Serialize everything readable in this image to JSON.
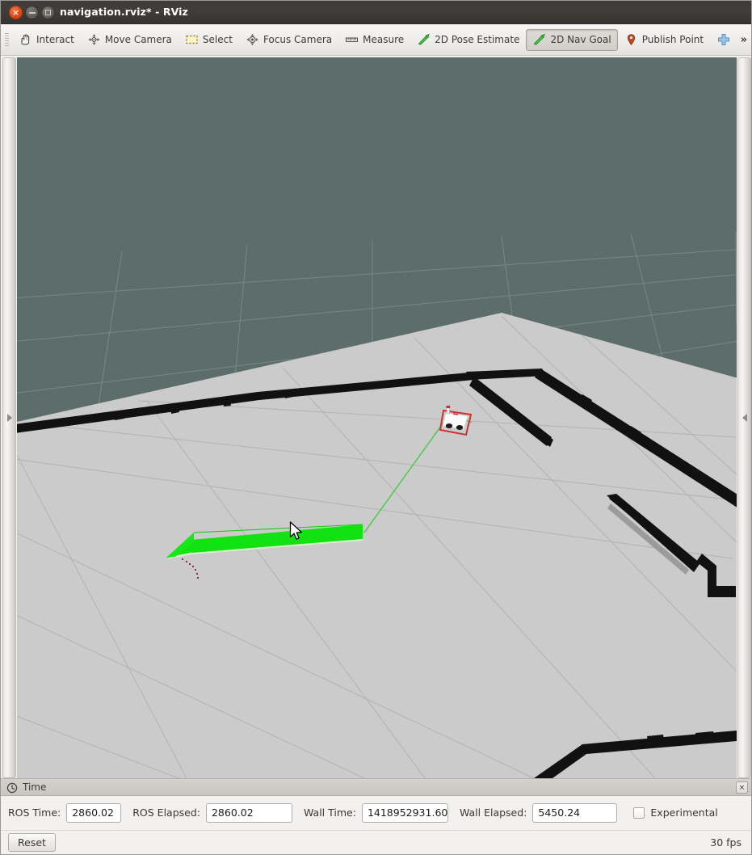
{
  "window": {
    "title": "navigation.rviz* - RViz",
    "buttons": {
      "close": "×",
      "minimize": "minimize",
      "maximize": "maximize"
    }
  },
  "toolbar": {
    "items": [
      {
        "label": "Interact",
        "icon": "hand-icon",
        "pressed": false
      },
      {
        "label": "Move Camera",
        "icon": "move-camera-icon",
        "pressed": false
      },
      {
        "label": "Select",
        "icon": "select-rect-icon",
        "pressed": false
      },
      {
        "label": "Focus Camera",
        "icon": "focus-camera-icon",
        "pressed": false
      },
      {
        "label": "Measure",
        "icon": "ruler-icon",
        "pressed": false
      },
      {
        "label": "2D Pose Estimate",
        "icon": "pose-arrow-icon",
        "pressed": false
      },
      {
        "label": "2D Nav Goal",
        "icon": "nav-goal-arrow-icon",
        "pressed": true
      },
      {
        "label": "Publish Point",
        "icon": "map-pin-icon",
        "pressed": false
      }
    ],
    "add_tool_icon": "plus-icon",
    "overflow_label": "»"
  },
  "viewport": {
    "background_color": "#5d6d69",
    "floor_color": "#c9c9c9",
    "grid_line_color": "#8f9e9a",
    "floor_grid_color": "#b4b4b4",
    "obstacle_color": "#111111",
    "goal_arrow_color": "#12e212",
    "laser_scan_color": "#c21bc2",
    "path_line_color": "#4cc94c",
    "footprint_color": "#d03030",
    "robot_body_color": "#ffffff",
    "cursor": "arrow-cursor"
  },
  "time_panel": {
    "icon": "clock-icon",
    "title": "Time",
    "close_label": "×",
    "fields": [
      {
        "label": "ROS Time:",
        "value": "2860.02",
        "name": "ros-time"
      },
      {
        "label": "ROS Elapsed:",
        "value": "2860.02",
        "name": "ros-elapsed"
      },
      {
        "label": "Wall Time:",
        "value": "1418952931.60",
        "name": "wall-time"
      },
      {
        "label": "Wall Elapsed:",
        "value": "5450.24",
        "name": "wall-elapsed"
      }
    ],
    "experimental": {
      "label": "Experimental",
      "checked": false
    }
  },
  "status_bar": {
    "reset_label": "Reset",
    "fps": "30 fps"
  }
}
